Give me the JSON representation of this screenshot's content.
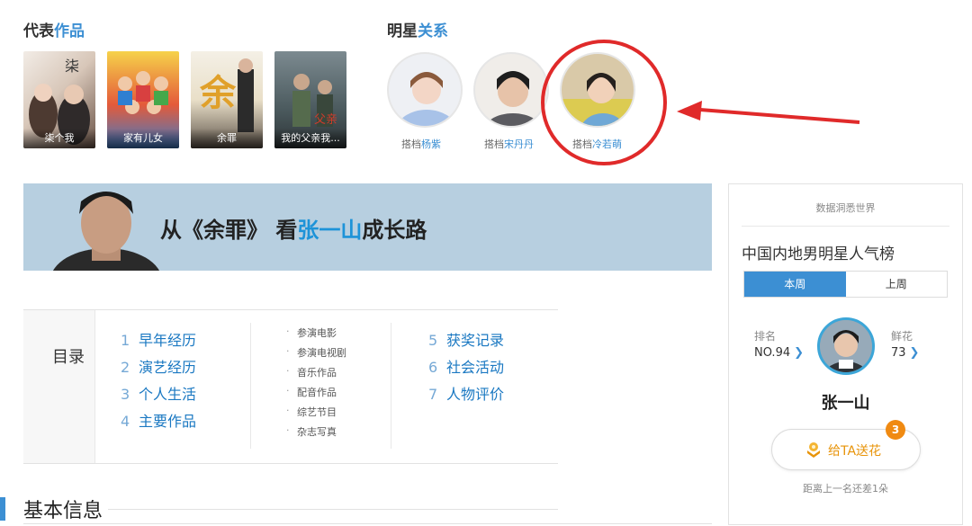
{
  "works": {
    "title_black": "代表",
    "title_blue": "作品",
    "items": [
      {
        "label": "柒个我"
      },
      {
        "label": "家有儿女"
      },
      {
        "label": "余罪"
      },
      {
        "label": "我的父亲我..."
      }
    ]
  },
  "relations": {
    "title_black": "明星",
    "title_blue": "关系",
    "items": [
      {
        "prefix": "搭档",
        "name": "杨紫"
      },
      {
        "prefix": "搭档",
        "name": "宋丹丹"
      },
      {
        "prefix": "搭档",
        "name": "冷若萌"
      }
    ]
  },
  "banner": {
    "part1": "从《余罪》 看",
    "highlight": "张一山",
    "part2": "成长路"
  },
  "toc": {
    "label": "目录",
    "col1": [
      {
        "num": "1",
        "text": "早年经历"
      },
      {
        "num": "2",
        "text": "演艺经历"
      },
      {
        "num": "3",
        "text": "个人生活"
      },
      {
        "num": "4",
        "text": "主要作品"
      }
    ],
    "sub": [
      "参演电影",
      "参演电视剧",
      "音乐作品",
      "配音作品",
      "综艺节目",
      "杂志写真"
    ],
    "col3": [
      {
        "num": "5",
        "text": "获奖记录"
      },
      {
        "num": "6",
        "text": "社会活动"
      },
      {
        "num": "7",
        "text": "人物评价"
      }
    ]
  },
  "basic": {
    "title": "基本信息"
  },
  "panel": {
    "header": "数据洞悉世界",
    "title": "中国内地男明星人气榜",
    "tabs": [
      "本周",
      "上周"
    ],
    "rank_label": "排名",
    "rank_value": "NO.94",
    "flower_label": "鲜花",
    "flower_value": "73",
    "star_name": "张一山",
    "button_label": "给TA送花",
    "badge": "3",
    "footer": "距离上一名还差1朵"
  },
  "colors": {
    "accent_blue": "#3c8fd3",
    "highlight_red": "#e02a2a",
    "flower_orange": "#e8940a"
  }
}
